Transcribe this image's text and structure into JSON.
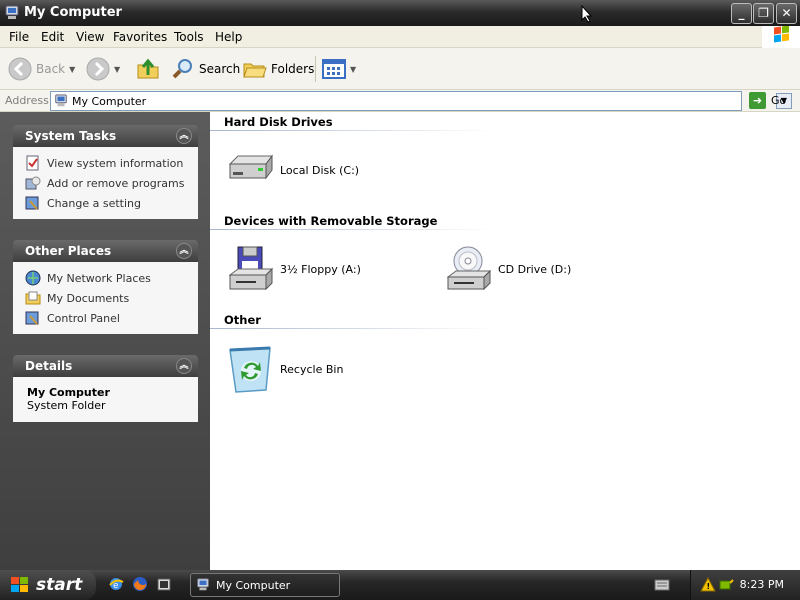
{
  "window": {
    "title": "My Computer",
    "buttons": {
      "minimize": "_",
      "maximize": "❐",
      "close": "✕"
    }
  },
  "menubar": {
    "items": [
      "File",
      "Edit",
      "View",
      "Favorites",
      "Tools",
      "Help"
    ]
  },
  "toolbar": {
    "back_label": "Back",
    "search_label": "Search",
    "folders_label": "Folders"
  },
  "addressbar": {
    "label": "Address",
    "value": "My Computer",
    "go_label": "Go"
  },
  "tasks": {
    "system": {
      "header": "System Tasks",
      "items": [
        "View system information",
        "Add or remove programs",
        "Change a setting"
      ]
    },
    "other": {
      "header": "Other Places",
      "items": [
        "My Network Places",
        "My Documents",
        "Control Panel"
      ]
    },
    "details": {
      "header": "Details",
      "name": "My Computer",
      "type": "System Folder"
    }
  },
  "content": {
    "groups": [
      {
        "title": "Hard Disk Drives",
        "items": [
          "Local Disk (C:)"
        ]
      },
      {
        "title": "Devices with Removable Storage",
        "items": [
          "3½ Floppy (A:)",
          "CD Drive (D:)"
        ]
      },
      {
        "title": "Other",
        "items": [
          "Recycle Bin"
        ]
      }
    ]
  },
  "taskbar": {
    "start_label": "start",
    "window_button": "My Computer",
    "clock": "8:23 PM"
  },
  "icons": {
    "accent": "#3f9a34",
    "names": [
      "my-computer-icon",
      "back-arrow-icon",
      "forward-arrow-icon",
      "up-folder-icon",
      "search-icon",
      "folders-icon",
      "views-icon",
      "go-arrow-icon",
      "hard-disk-icon",
      "floppy-drive-icon",
      "cd-drive-icon",
      "recycle-bin-icon"
    ]
  }
}
